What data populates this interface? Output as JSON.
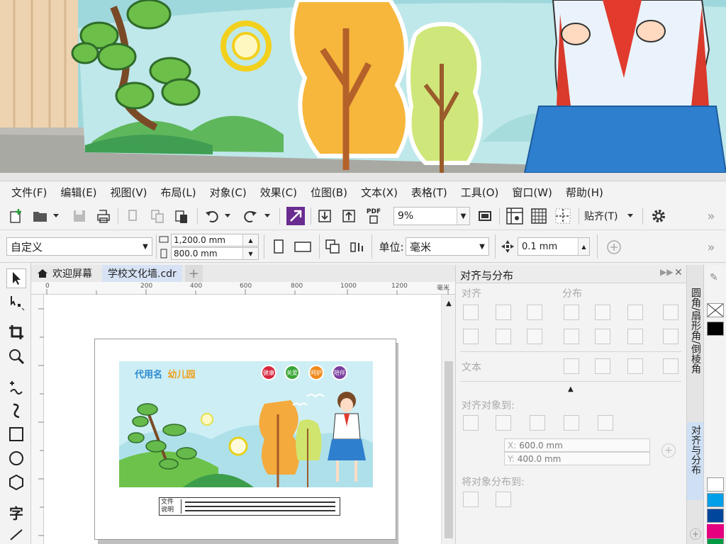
{
  "menu": [
    "文件(F)",
    "编辑(E)",
    "视图(V)",
    "布局(L)",
    "对象(C)",
    "效果(C)",
    "位图(B)",
    "文本(X)",
    "表格(T)",
    "工具(O)",
    "窗口(W)",
    "帮助(H)"
  ],
  "toolbar": {
    "zoom_value": "9%",
    "snap_label": "贴齐(T)",
    "pdf_label": "PDF",
    "more": "»"
  },
  "property_bar": {
    "preset": "自定义",
    "width": "1,200.0 mm",
    "height": "800.0 mm",
    "unit_label": "单位:",
    "unit_value": "毫米",
    "nudge": "0.1 mm",
    "more": "»"
  },
  "tabs": {
    "welcome": "欢迎屏幕",
    "document": "学校文化墙.cdr",
    "add": "+"
  },
  "ruler": {
    "ticks": [
      "0",
      "200",
      "400",
      "600",
      "800",
      "1000",
      "1200"
    ],
    "unit": "毫米"
  },
  "artwork": {
    "title_part1": "代用名",
    "title_part2": "幼儿园",
    "badges": [
      {
        "text": "健康",
        "color": "#d7263d"
      },
      {
        "text": "关爱",
        "color": "#3aa635"
      },
      {
        "text": "呵护",
        "color": "#f08a1c"
      },
      {
        "text": "陪伴",
        "color": "#7b3fa0"
      }
    ],
    "caption_label": "文件\n说明"
  },
  "docker": {
    "title": "对齐与分布",
    "section_align": "对齐",
    "section_distribute": "分布",
    "section_text": "文本",
    "align_to": "对齐对象到:",
    "x_label": "X:",
    "x_value": "600.0 mm",
    "y_label": "Y:",
    "y_value": "400.0 mm",
    "distribute_to": "将对象分布到:"
  },
  "right_tabs": {
    "tab1": "圆角/扇形角/倒棱角",
    "tab2": "对齐与分布"
  },
  "palette_colors": [
    "#ffffff",
    "#000000",
    "#ffffff",
    "#00a0e9",
    "#00469c",
    "#e4007f",
    "#009944"
  ],
  "colors": {
    "accent": "#2b57c4",
    "snap_purple": "#6a2c91"
  }
}
